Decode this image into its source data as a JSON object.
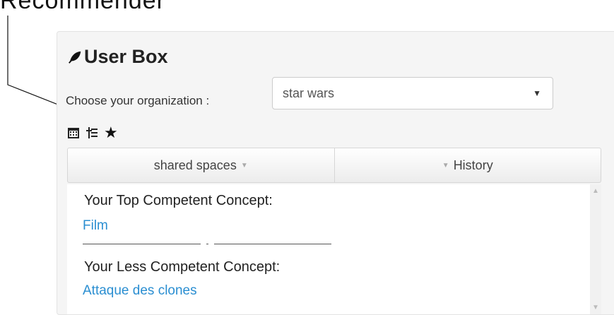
{
  "callout": {
    "text": "Recommender"
  },
  "user_box": {
    "title": "User Box",
    "org_label": "Choose your organization :",
    "org_select_value": "star wars",
    "tabs": [
      "shared spaces",
      "History"
    ],
    "top_label": "Your Top Competent Concept:",
    "top_value": "Film",
    "less_label": "Your Less Competent Concept:",
    "less_value": "Attaque des clones"
  },
  "icons": [
    "leaf-icon",
    "calendar-icon",
    "tree-list-icon",
    "star-icon",
    "caret-down-icon"
  ],
  "colors": {
    "link": "#2a8ed1",
    "panel_bg": "#f5f5f5"
  }
}
